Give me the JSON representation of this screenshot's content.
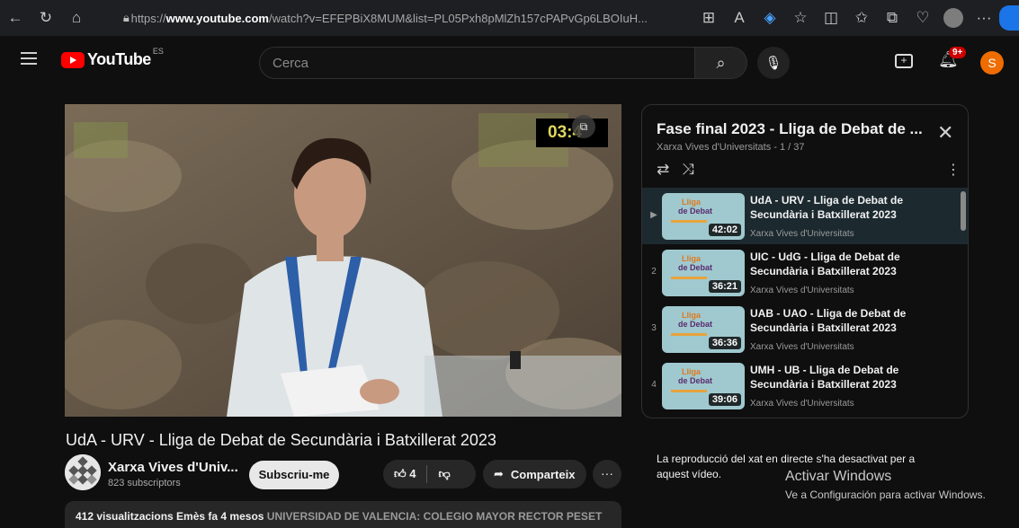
{
  "browser": {
    "url_prefix": "https://",
    "url_domain": "www.youtube.com",
    "url_rest": "/watch?v=EFEPBiX8MUM&list=PL05Pxh8pMlZh157cPAPvGp6LBOIuH..."
  },
  "header": {
    "logo_text": "YouTube",
    "country_code": "ES",
    "search_placeholder": "Cerca",
    "notification_badge": "9+",
    "avatar_letter": "S"
  },
  "player": {
    "timestamp": "03:4"
  },
  "video": {
    "title": "UdA - URV - Lliga de Debat de Secundària i Batxillerat 2023",
    "channel_name": "Xarxa Vives d'Univ...",
    "subscribers": "823 subscriptors",
    "subscribe_label": "Subscriu-me",
    "likes": "4",
    "share_label": "Comparteix",
    "description_bold": "412 visualitzacions  Emès fa 4 mesos",
    "description_rest": "  UNIVERSIDAD DE VALENCIA: COLEGIO MAYOR RECTOR PESET"
  },
  "playlist": {
    "title": "Fase final 2023 - Lliga de Debat de ...",
    "subtitle": "Xarxa Vives d'Universitats - 1 / 37",
    "items": [
      {
        "index": "▶",
        "title": "UdA - URV - Lliga de Debat de Secundària i Batxillerat 2023",
        "channel": "Xarxa Vives d'Universitats",
        "duration": "42:02",
        "active": true
      },
      {
        "index": "2",
        "title": "UIC - UdG - Lliga de Debat de Secundària i Batxillerat 2023",
        "channel": "Xarxa Vives d'Universitats",
        "duration": "36:21",
        "active": false
      },
      {
        "index": "3",
        "title": "UAB - UAO - Lliga de Debat de Secundària i Batxillerat 2023",
        "channel": "Xarxa Vives d'Universitats",
        "duration": "36:36",
        "active": false
      },
      {
        "index": "4",
        "title": "UMH - UB - Lliga de Debat de Secundària i Batxillerat 2023",
        "channel": "Xarxa Vives d'Universitats",
        "duration": "39:06",
        "active": false
      }
    ],
    "thumb_logo_line1": "Lliga",
    "thumb_logo_line2": "de Debat"
  },
  "chat": {
    "disabled_message": "La reproducció del xat en directe s'ha desactivat per a aquest vídeo."
  },
  "windows_watermark": {
    "line1": "Activar Windows",
    "line2": "Ve a Configuración para activar Windows."
  },
  "colors": {
    "brand_red": "#ff0000",
    "avatar_orange": "#ef6c00",
    "timestamp_yellow": "#ddd85c"
  }
}
